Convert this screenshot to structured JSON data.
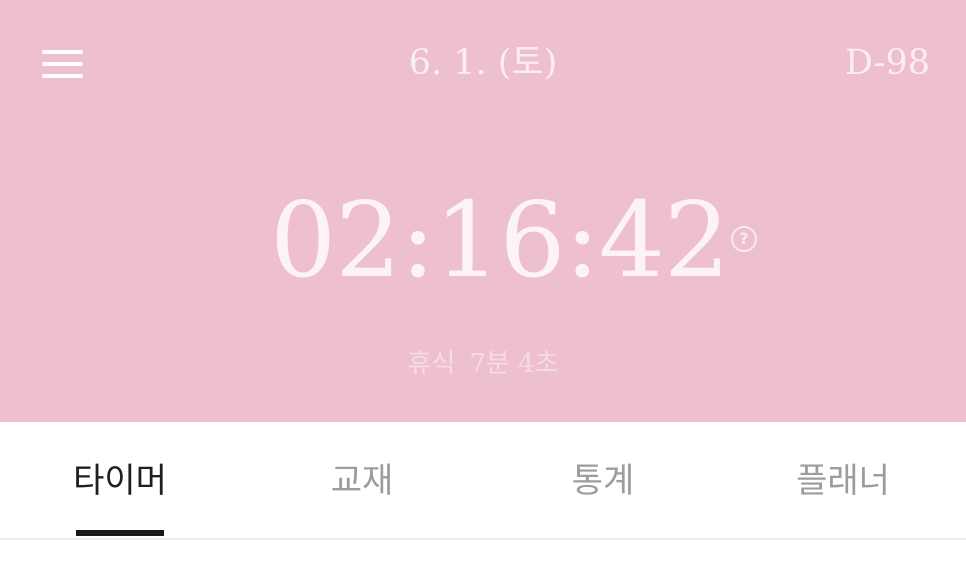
{
  "header": {
    "date": "6. 1. (토)",
    "dday": "D-98",
    "menu_icon": "hamburger-menu-icon"
  },
  "timer": {
    "display": "02:16:42",
    "help_icon": "question-circle-icon",
    "help_glyph": "?"
  },
  "rest": {
    "label": "휴식",
    "value": "7분 4초"
  },
  "tabs": [
    {
      "label": "타이머",
      "active": true
    },
    {
      "label": "교재",
      "active": false
    },
    {
      "label": "통계",
      "active": false
    },
    {
      "label": "플래너",
      "active": false
    }
  ],
  "colors": {
    "hero_background": "#edbfcf",
    "tab_active": "#1f1f1f",
    "tab_inactive": "#9c9c9c"
  }
}
